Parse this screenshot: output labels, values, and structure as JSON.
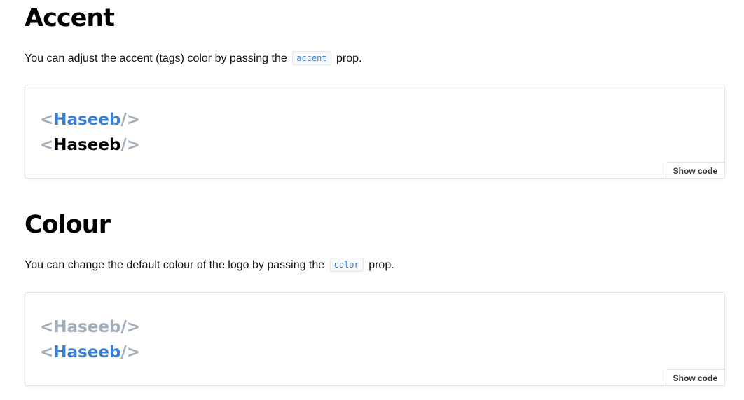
{
  "accent_section": {
    "title": "Accent",
    "description_before": "You can adjust the accent (tags) color by passing the",
    "code": "accent",
    "description_after": "prop.",
    "examples": [
      {
        "open_tag": "<",
        "name": "Haseeb",
        "close_tag": "/>",
        "tag_color": "#a0adbb",
        "name_color": "#3b7fd4"
      },
      {
        "open_tag": "<",
        "name": "Haseeb",
        "close_tag": "/>",
        "tag_color": "#a0adbb",
        "name_color": "#000000"
      }
    ],
    "show_code_label": "Show code"
  },
  "colour_section": {
    "title": "Colour",
    "description_before": "You can change the default colour of the logo by passing the",
    "code": "color",
    "description_after": "prop.",
    "examples": [
      {
        "open_tag": "<",
        "name": "Haseeb",
        "close_tag": "/>",
        "tag_color": "#a0adbb",
        "name_color": "#a0adbb"
      },
      {
        "open_tag": "<",
        "name": "Haseeb",
        "close_tag": "/>",
        "tag_color": "#a0adbb",
        "name_color": "#3b7fd4"
      }
    ],
    "show_code_label": "Show code"
  },
  "colors": {
    "code_text": "#3b7fd4",
    "heading": "#000000",
    "body_text": "#111111"
  }
}
